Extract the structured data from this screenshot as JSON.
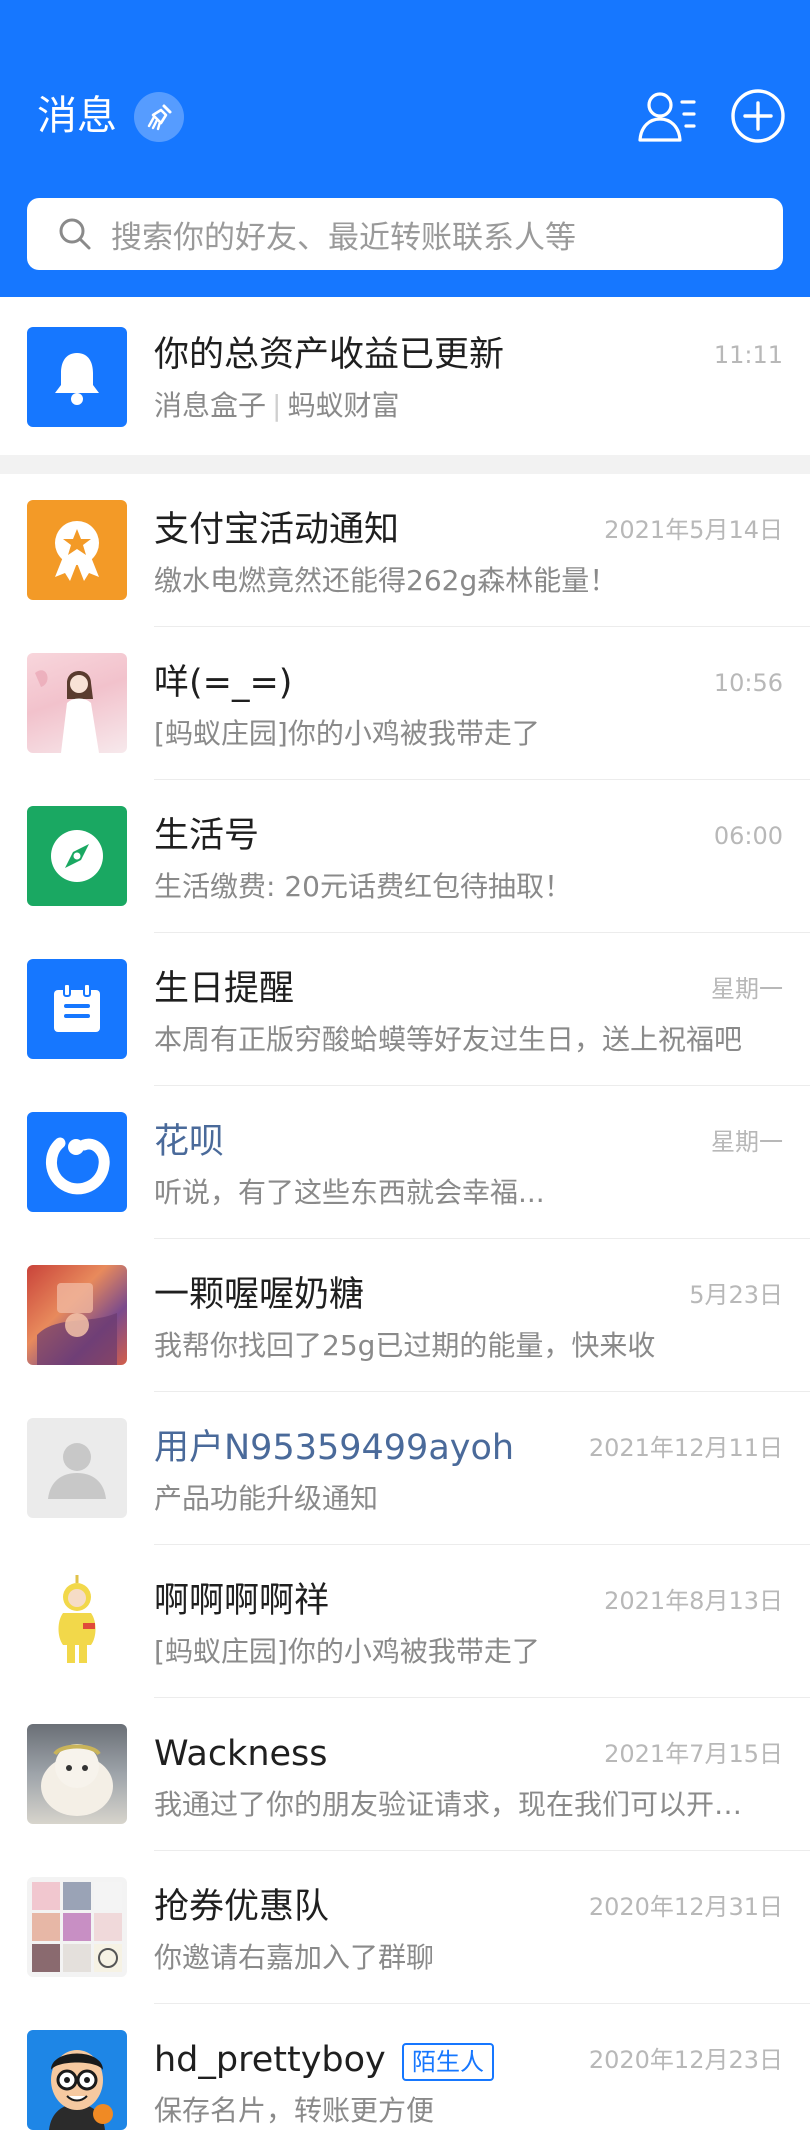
{
  "header": {
    "title": "消息",
    "search_placeholder": "搜索你的好友、最近转账联系人等",
    "bg_color": "#1677ff"
  },
  "pinned": {
    "title": "你的总资产收益已更新",
    "source": "消息盒子",
    "source2": "蚂蚁财富",
    "time": "11:11",
    "icon": "bell-icon"
  },
  "messages": [
    {
      "name": "支付宝活动通知",
      "preview": "缴水电燃竟然还能得262g森林能量！",
      "time": "2021年5月14日",
      "icon": "medal-icon"
    },
    {
      "name": "咩(=_=)",
      "preview": "[蚂蚁庄园]你的小鸡被我带走了",
      "time": "10:56",
      "icon": "user-photo"
    },
    {
      "name": "生活号",
      "preview": "生活缴费: 20元话费红包待抽取！",
      "time": "06:00",
      "icon": "compass-icon"
    },
    {
      "name": "生日提醒",
      "preview": "本周有正版穷酸蛤蟆等好友过生日，送上祝福吧",
      "time": "星期一",
      "icon": "calendar-icon"
    },
    {
      "name": "花呗",
      "preview": "听说，有了这些东西就会幸福...",
      "time": "星期一",
      "icon": "huabei-icon"
    },
    {
      "name": "一颗喔喔奶糖",
      "preview": "我帮你找回了25g已过期的能量，快来收",
      "time": "5月23日",
      "icon": "user-photo"
    },
    {
      "name": "用户N95359499ayoh",
      "preview": "产品功能升级通知",
      "time": "2021年12月11日",
      "icon": "default-avatar-icon"
    },
    {
      "name": "啊啊啊啊祥",
      "preview": "[蚂蚁庄园]你的小鸡被我带走了",
      "time": "2021年8月13日",
      "icon": "user-photo"
    },
    {
      "name": "Wackness",
      "preview": "我通过了你的朋友验证请求，现在我们可以开始聊天了",
      "time": "2021年7月15日",
      "icon": "user-photo"
    },
    {
      "name": "抢券优惠队",
      "preview": "你邀请右嘉加入了群聊",
      "time": "2020年12月31日",
      "icon": "group-avatar"
    },
    {
      "name": "hd_prettyboy",
      "tag": "陌生人",
      "preview": "保存名片，转账更方便",
      "time": "2020年12月23日",
      "icon": "cartoon-avatar"
    }
  ]
}
